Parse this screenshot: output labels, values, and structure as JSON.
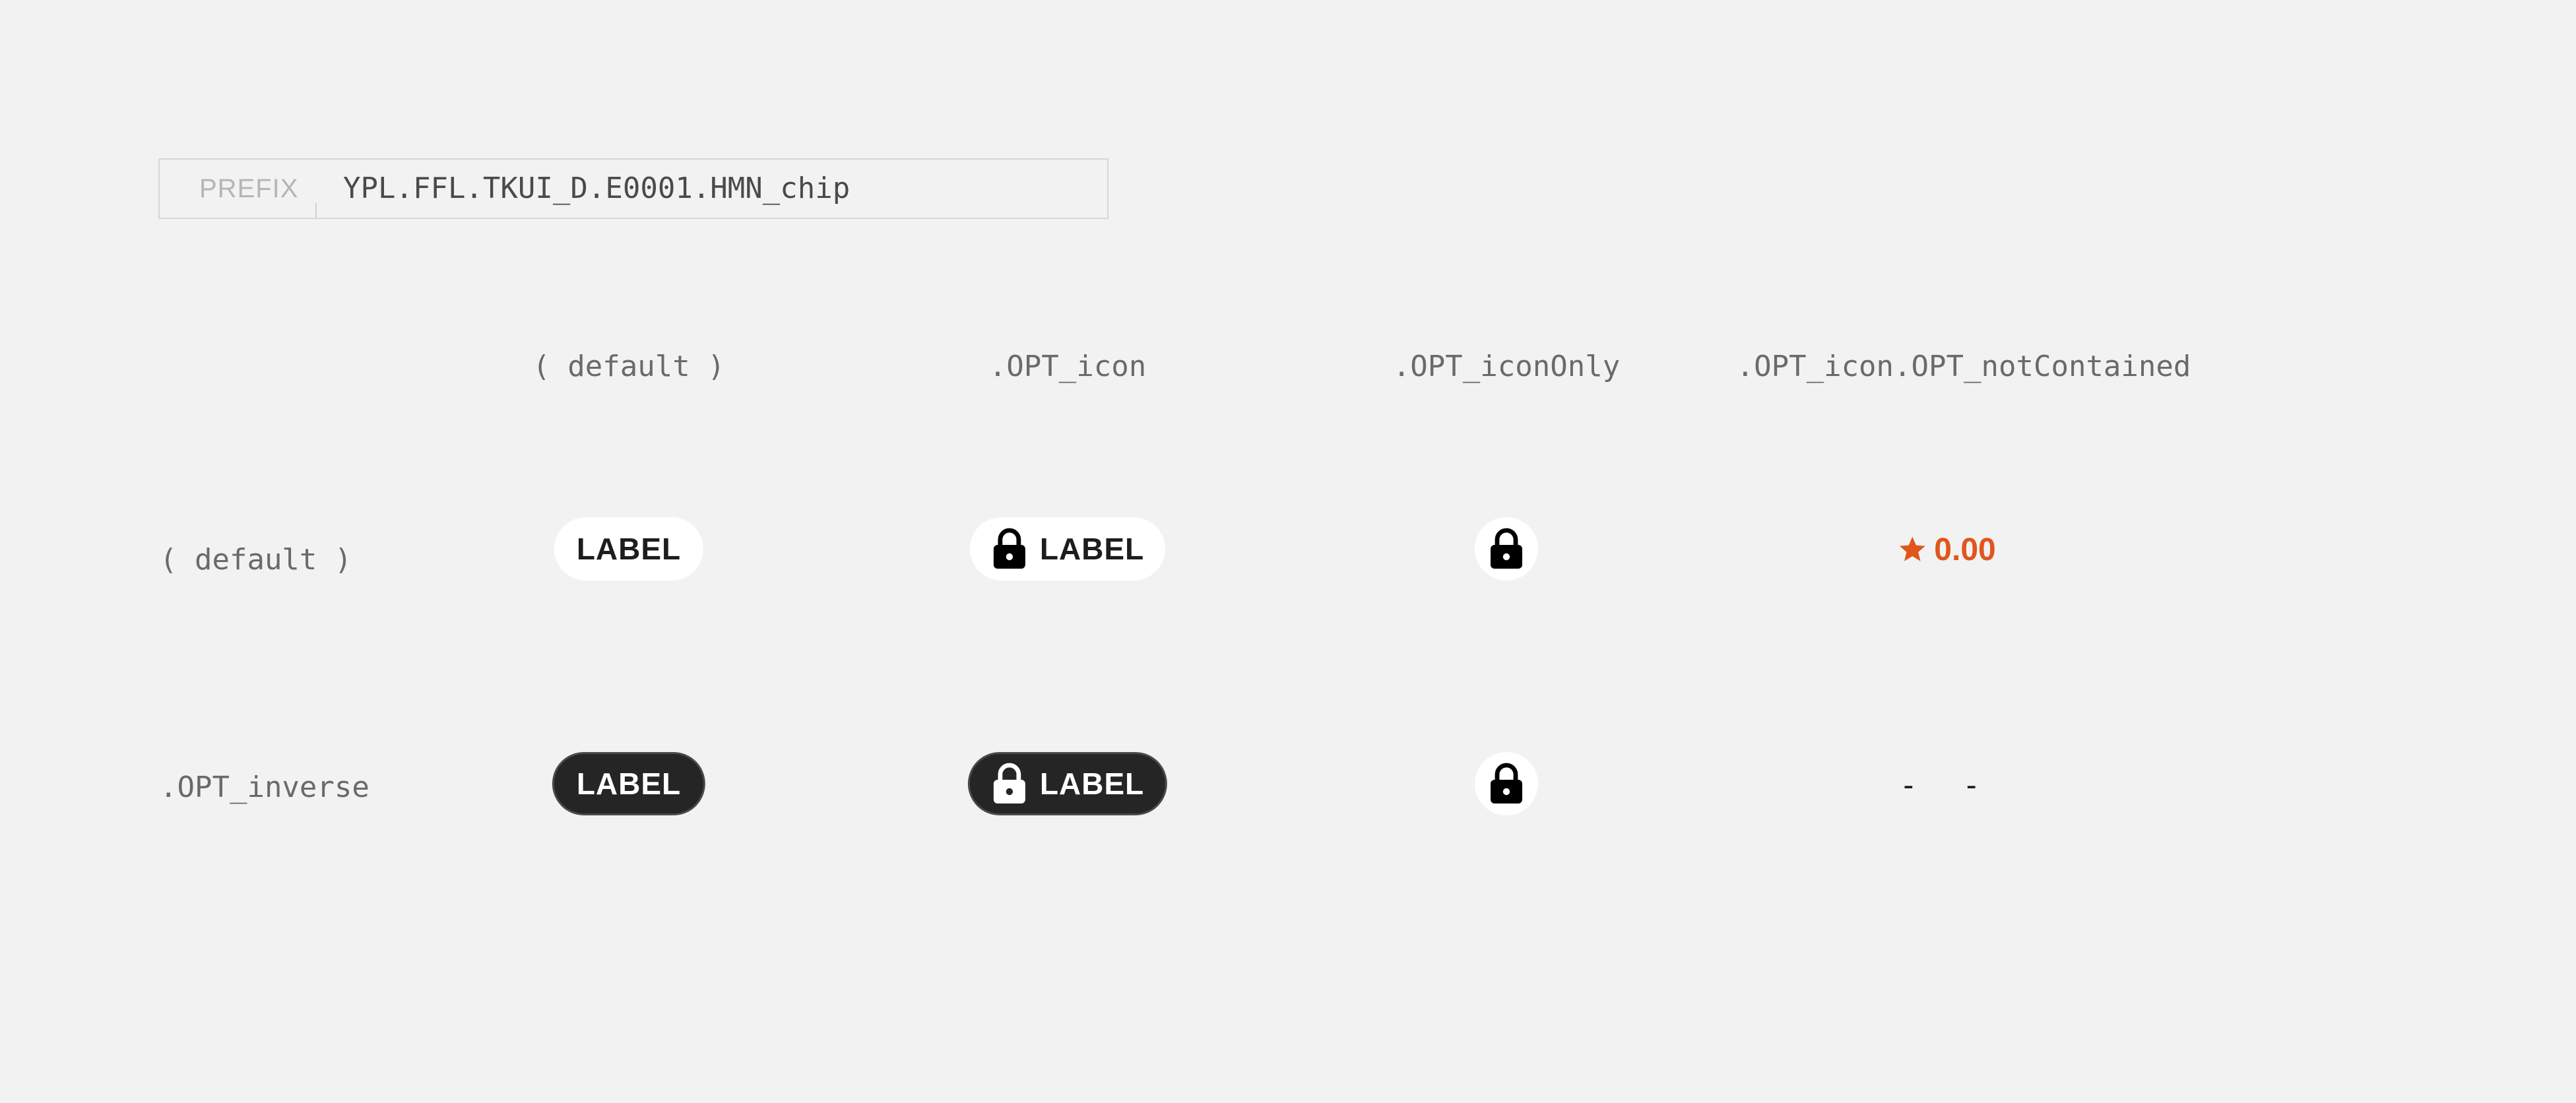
{
  "prefix": {
    "label": "PREFIX",
    "value": "YPL.FFL.TKUI_D.E0001.HMN_chip"
  },
  "columns": [
    "( default )",
    ".OPT_icon",
    ".OPT_iconOnly",
    ".OPT_icon.OPT_notContained"
  ],
  "rows": [
    "( default )",
    ".OPT_inverse"
  ],
  "chips": {
    "default_label": "LABEL",
    "icon_label": "LABEL",
    "inverse_label": "LABEL",
    "inverse_icon_label": "LABEL",
    "icon_name": "lock-icon",
    "not_contained_value": "0.00",
    "not_contained_icon": "star-icon",
    "inverse_not_contained_placeholder": "- -"
  },
  "colors": {
    "background": "#f2f2f2",
    "chip_light_bg": "#ffffff",
    "chip_dark_bg": "#252525",
    "accent_orange": "#e0561b"
  }
}
